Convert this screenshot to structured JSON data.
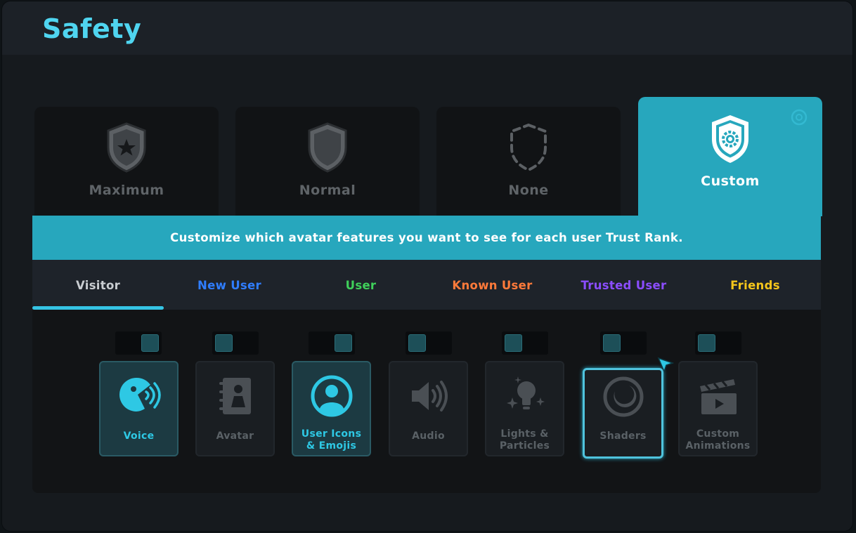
{
  "window": {
    "title": "Safety"
  },
  "levels": [
    {
      "label": "Maximum",
      "icon": "shield-star-icon",
      "active": false
    },
    {
      "label": "Normal",
      "icon": "shield-icon",
      "active": false
    },
    {
      "label": "None",
      "icon": "shield-dashed-icon",
      "active": false
    },
    {
      "label": "Custom",
      "icon": "shield-gear-icon",
      "active": true
    }
  ],
  "banner": {
    "text": "Customize which avatar features you want to see for each user Trust Rank."
  },
  "tabs": [
    {
      "label": "Visitor",
      "color": "#c9cdd1",
      "selected": true
    },
    {
      "label": "New User",
      "color": "#2f7dff"
    },
    {
      "label": "User",
      "color": "#3fcf5a"
    },
    {
      "label": "Known User",
      "color": "#ff7a3a"
    },
    {
      "label": "Trusted User",
      "color": "#8b4dff"
    },
    {
      "label": "Friends",
      "color": "#f5c61b"
    }
  ],
  "features": [
    {
      "label1": "Voice",
      "label2": "",
      "enabled": true,
      "icon": "voice-icon"
    },
    {
      "label1": "Avatar",
      "label2": "",
      "enabled": false,
      "icon": "avatar-book-icon"
    },
    {
      "label1": "User Icons",
      "label2": "& Emojis",
      "enabled": true,
      "icon": "user-circle-icon"
    },
    {
      "label1": "Audio",
      "label2": "",
      "enabled": false,
      "icon": "speaker-icon"
    },
    {
      "label1": "Lights &",
      "label2": "Particles",
      "enabled": false,
      "icon": "lightbulb-sparkle-icon"
    },
    {
      "label1": "Shaders",
      "label2": "",
      "enabled": false,
      "selected": true,
      "icon": "moon-circle-icon"
    },
    {
      "label1": "Custom",
      "label2": "Animations",
      "enabled": false,
      "icon": "clapperboard-icon"
    }
  ],
  "colors": {
    "accent": "#27a7bd",
    "title": "#4fd5f0",
    "enabled_text": "#2ec8e4",
    "disabled_text": "#5a6166"
  }
}
